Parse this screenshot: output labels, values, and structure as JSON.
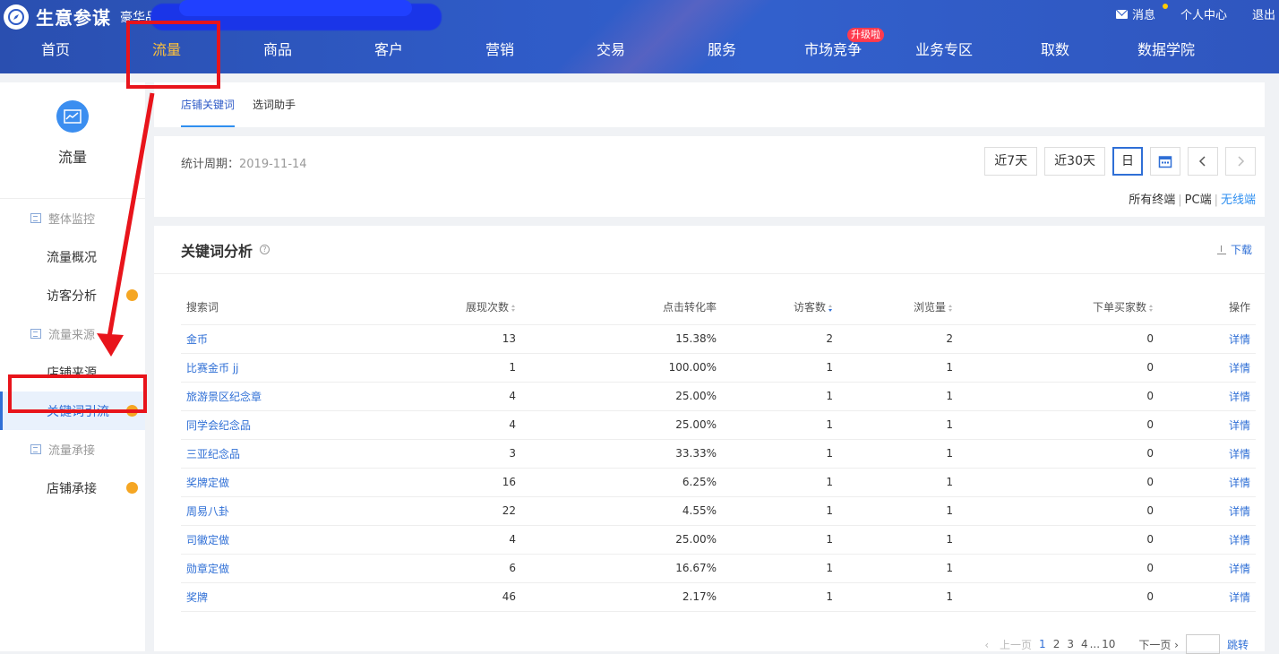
{
  "header": {
    "app_title": "生意参谋",
    "shop_name": "豪华品",
    "top_links": {
      "messages": "消息",
      "profile": "个人中心",
      "logout": "退出"
    },
    "nav": [
      "首页",
      "流量",
      "商品",
      "客户",
      "营销",
      "交易",
      "服务",
      "市场竞争",
      "业务专区",
      "取数",
      "数据学院"
    ],
    "upgrade_badge": "升级啦"
  },
  "sidebar": {
    "title": "流量",
    "groups": [
      {
        "label": "整体监控",
        "items": [
          "流量概况",
          "访客分析"
        ]
      },
      {
        "label": "流量来源",
        "items": [
          "店铺来源",
          "关键词引流"
        ]
      },
      {
        "label": "流量承接",
        "items": [
          "店铺承接"
        ]
      }
    ]
  },
  "subtabs": [
    "店铺关键词",
    "选词助手"
  ],
  "period": {
    "label": "统计周期：",
    "date": "2019-11-14",
    "btn_7d": "近7天",
    "btn_30d": "近30天",
    "btn_day": "日",
    "terminals": {
      "all": "所有终端",
      "pc": "PC端",
      "wireless": "无线端"
    }
  },
  "panel": {
    "title": "关键词分析",
    "download": "下载",
    "columns": [
      "搜索词",
      "展现次数",
      "点击转化率",
      "访客数",
      "浏览量",
      "下单买家数",
      "操作"
    ],
    "rows": [
      [
        "金币",
        "13",
        "15.38%",
        "2",
        "2",
        "0",
        "详情"
      ],
      [
        "比赛金币 jj",
        "1",
        "100.00%",
        "1",
        "1",
        "0",
        "详情"
      ],
      [
        "旅游景区纪念章",
        "4",
        "25.00%",
        "1",
        "1",
        "0",
        "详情"
      ],
      [
        "同学会纪念品",
        "4",
        "25.00%",
        "1",
        "1",
        "0",
        "详情"
      ],
      [
        "三亚纪念品",
        "3",
        "33.33%",
        "1",
        "1",
        "0",
        "详情"
      ],
      [
        "奖牌定做",
        "16",
        "6.25%",
        "1",
        "1",
        "0",
        "详情"
      ],
      [
        "周易八卦",
        "22",
        "4.55%",
        "1",
        "1",
        "0",
        "详情"
      ],
      [
        "司徽定做",
        "4",
        "25.00%",
        "1",
        "1",
        "0",
        "详情"
      ],
      [
        "勋章定做",
        "6",
        "16.67%",
        "1",
        "1",
        "0",
        "详情"
      ],
      [
        "奖牌",
        "46",
        "2.17%",
        "1",
        "1",
        "0",
        "详情"
      ]
    ]
  },
  "pager": {
    "prev": "上一页",
    "p1": "1",
    "p2": "2",
    "p3": "3",
    "p4": "4",
    "ellipsis": "...",
    "p10": "10",
    "next": "下一页",
    "jump": "跳转"
  }
}
